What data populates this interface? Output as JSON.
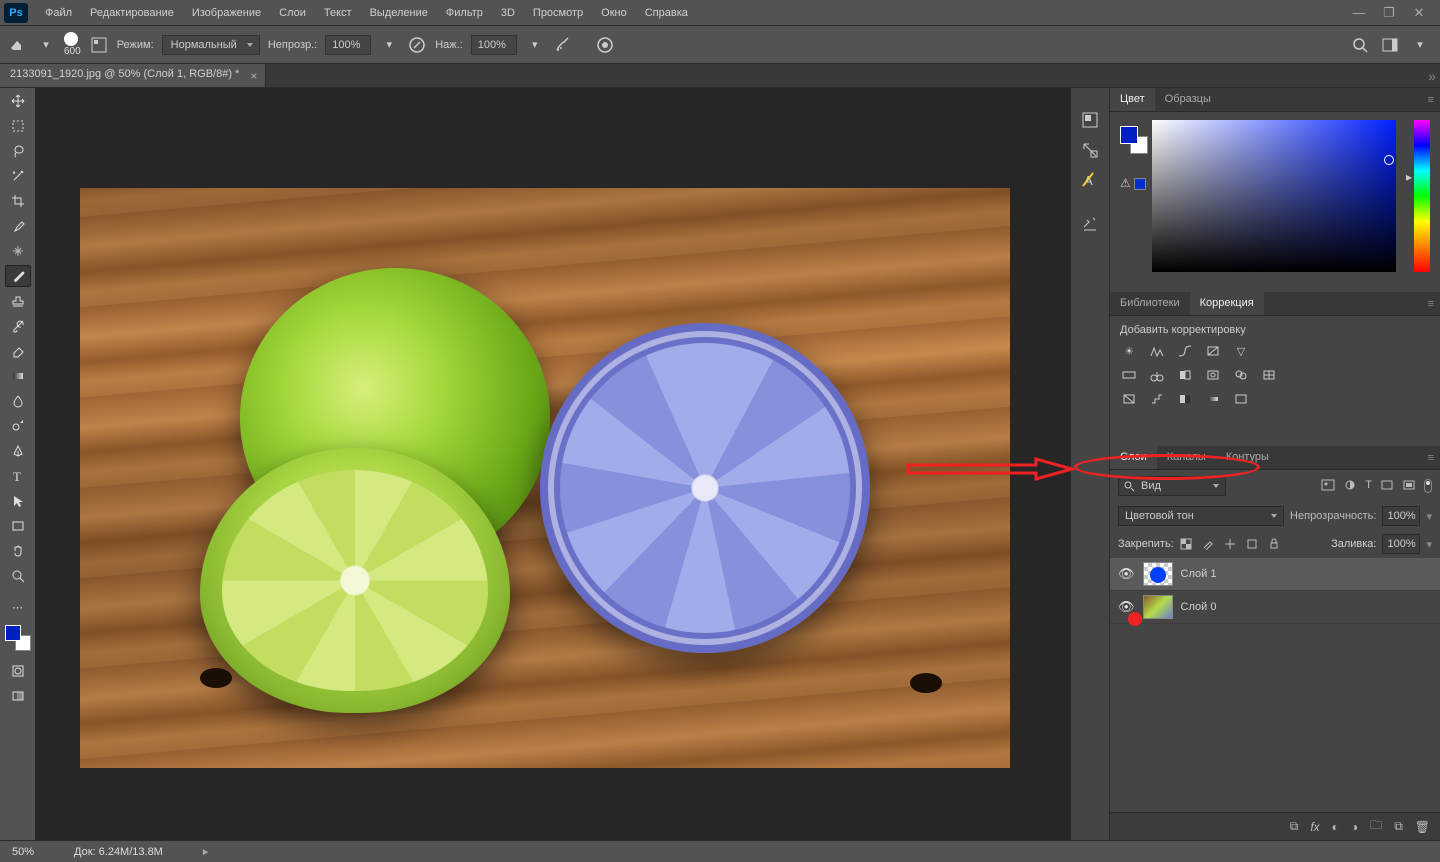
{
  "menubar": {
    "logo": "Ps",
    "items": [
      "Файл",
      "Редактирование",
      "Изображение",
      "Слои",
      "Текст",
      "Выделение",
      "Фильтр",
      "3D",
      "Просмотр",
      "Окно",
      "Справка"
    ]
  },
  "options": {
    "brush_size": "600",
    "mode_label": "Режим:",
    "mode_value": "Нормальный",
    "opacity_label": "Непрозр.:",
    "opacity_value": "100%",
    "flow_label": "Наж.:",
    "flow_value": "100%"
  },
  "tab": {
    "title": "2133091_1920.jpg @ 50% (Слой 1, RGB/8#) *"
  },
  "panels": {
    "color_tabs": [
      "Цвет",
      "Образцы"
    ],
    "lib_tabs": [
      "Библиотеки",
      "Коррекция"
    ],
    "adj_label": "Добавить корректировку",
    "layer_tabs": [
      "Слои",
      "Каналы",
      "Контуры"
    ]
  },
  "layers": {
    "kind_label": "Вид",
    "blend_mode": "Цветовой тон",
    "opacity_label": "Непрозрачность:",
    "opacity_value": "100%",
    "lock_label": "Закрепить:",
    "fill_label": "Заливка:",
    "fill_value": "100%",
    "items": [
      {
        "name": "Слой 1"
      },
      {
        "name": "Слой 0"
      }
    ]
  },
  "status": {
    "zoom": "50%",
    "doc": "Док: 6.24M/13.8M"
  }
}
